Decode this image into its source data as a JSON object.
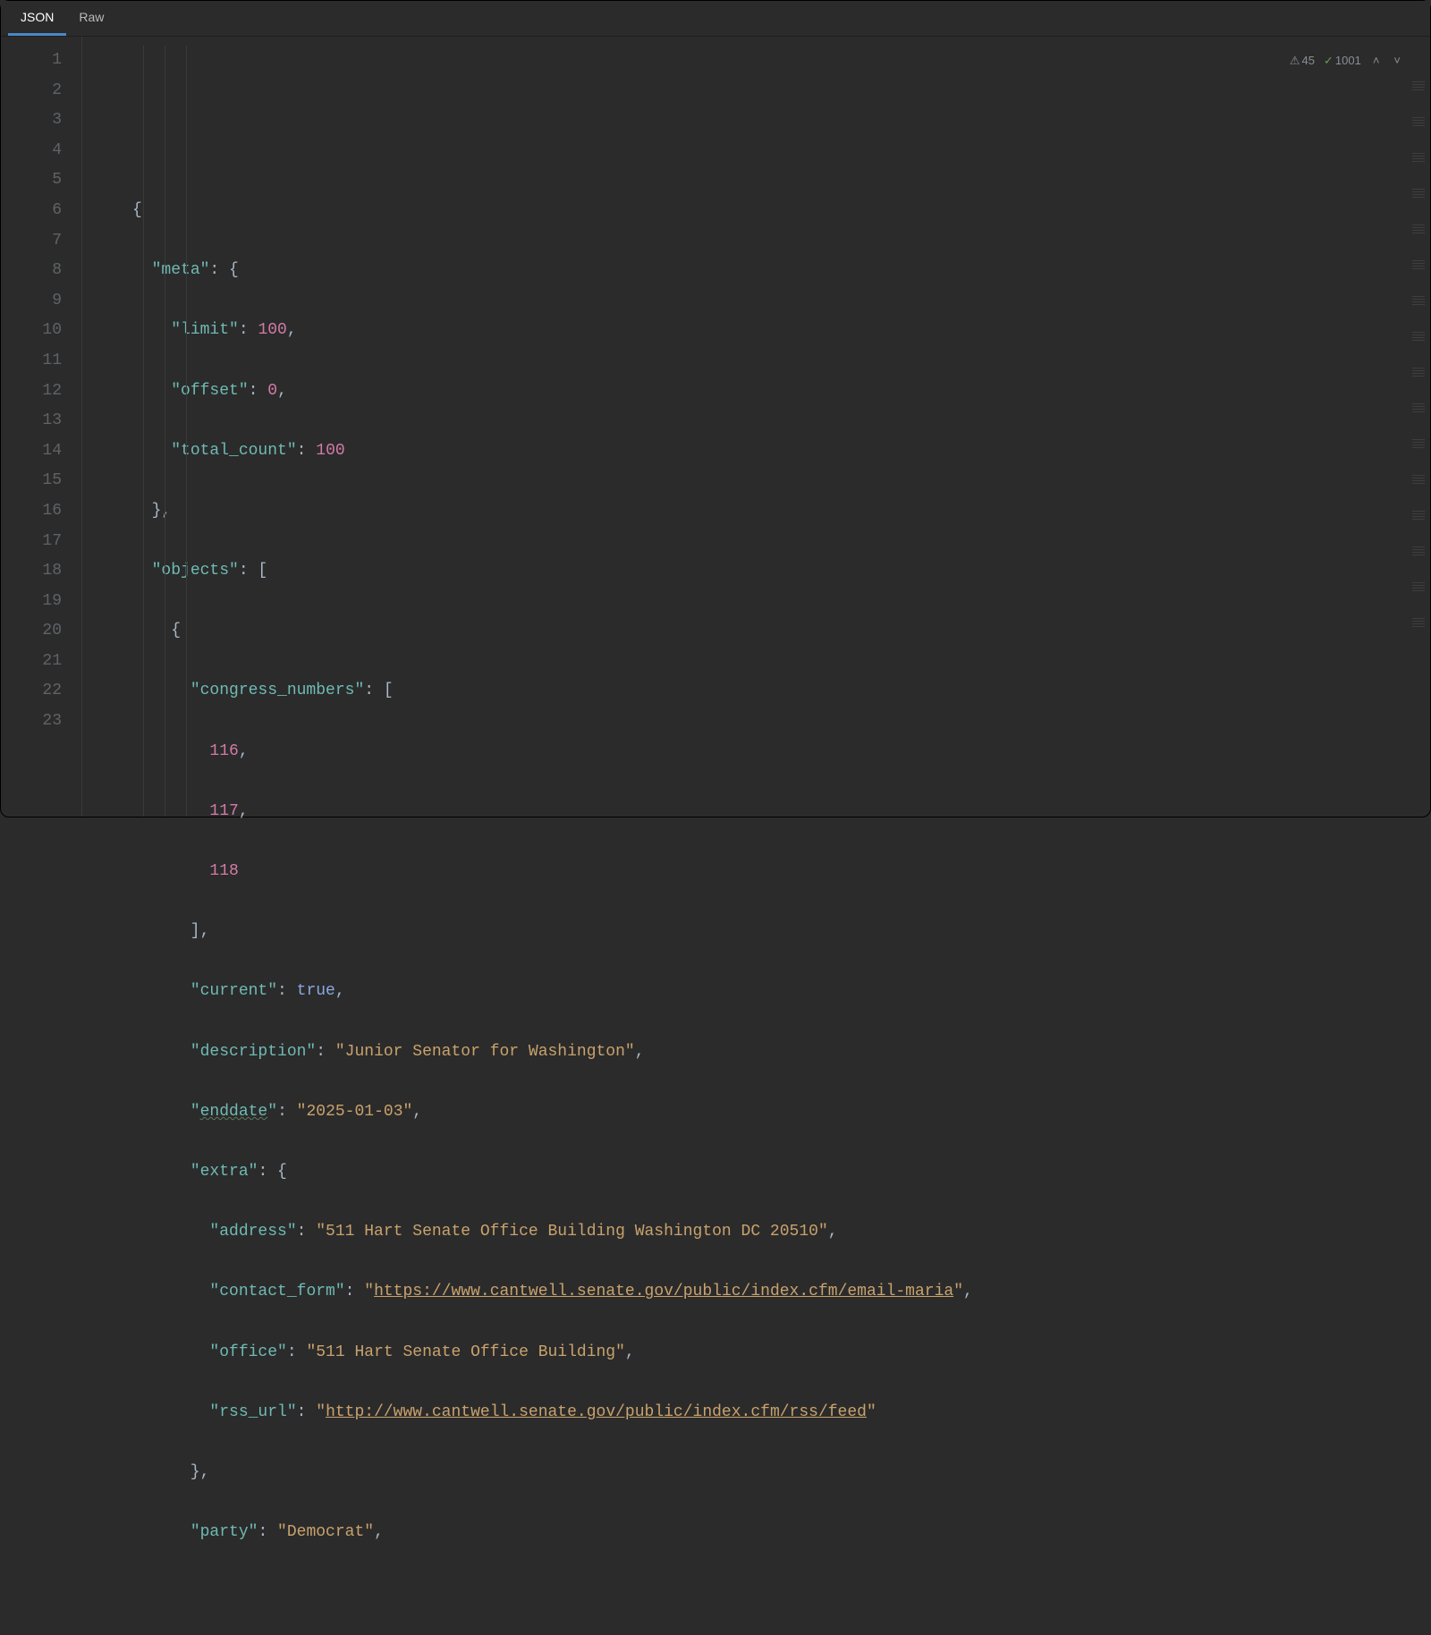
{
  "tabs": [
    {
      "label": "JSON",
      "active": true
    },
    {
      "label": "Raw",
      "active": false
    }
  ],
  "status": {
    "warnings": "45",
    "ok": "1001"
  },
  "lineNumbers": [
    "1",
    "2",
    "3",
    "4",
    "5",
    "6",
    "7",
    "8",
    "9",
    "10",
    "11",
    "12",
    "13",
    "14",
    "15",
    "16",
    "17",
    "18",
    "19",
    "20",
    "21",
    "22",
    "23"
  ],
  "code": {
    "l2_key": "\"meta\"",
    "l3_key": "\"limit\"",
    "l3_val": "100",
    "l4_key": "\"offset\"",
    "l4_val": "0",
    "l5_key": "\"total_count\"",
    "l5_val": "100",
    "l7_key": "\"objects\"",
    "l9_key": "\"congress_numbers\"",
    "l10_val": "116",
    "l11_val": "117",
    "l12_val": "118",
    "l14_key": "\"current\"",
    "l14_val": "true",
    "l15_key": "\"description\"",
    "l15_val": "\"Junior Senator for Washington\"",
    "l16_key": "\"",
    "l16_keyword": "enddate",
    "l16_keyclose": "\"",
    "l16_val": "\"2025-01-03\"",
    "l17_key": "\"extra\"",
    "l18_key": "\"address\"",
    "l18_val": "\"511 Hart Senate Office Building Washington DC 20510\"",
    "l19_key": "\"contact_form\"",
    "l19_q": "\"",
    "l19_url": "https://www.cantwell.senate.gov/public/index.cfm/email-maria",
    "l20_key": "\"office\"",
    "l20_val": "\"511 Hart Senate Office Building\"",
    "l21_key": "\"rss_url\"",
    "l21_q": "\"",
    "l21_url": "http://www.cantwell.senate.gov/public/index.cfm/rss/feed",
    "l23_key": "\"party\"",
    "l23_val": "\"Democrat\""
  }
}
